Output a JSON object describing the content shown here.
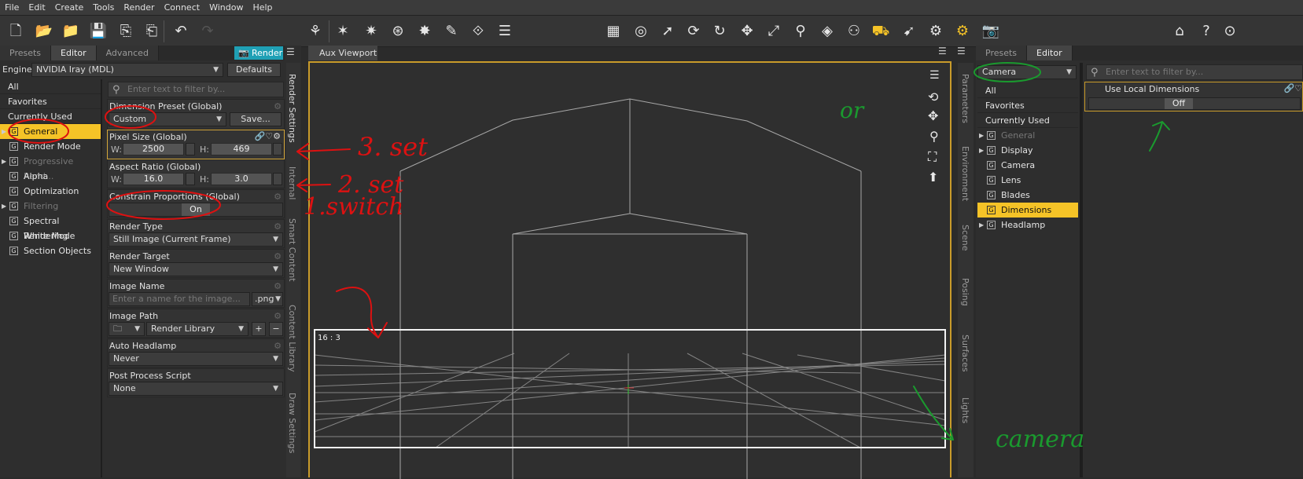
{
  "menubar": [
    "File",
    "Edit",
    "Create",
    "Tools",
    "Render",
    "Connect",
    "Window",
    "Help"
  ],
  "left_panel": {
    "tabs": [
      "Presets",
      "Editor",
      "Advanced"
    ],
    "render_button": "Render",
    "engine_label": "Engine :",
    "engine_value": "NVIDIA Iray (MDL)",
    "defaults_button": "Defaults",
    "groups": [
      {
        "label": "All",
        "type": "plain"
      },
      {
        "label": "Favorites",
        "type": "plain"
      },
      {
        "label": "Currently Used",
        "type": "plain"
      },
      {
        "label": "General",
        "type": "g",
        "state": "selected",
        "arrow": true
      },
      {
        "label": "Render Mode",
        "type": "g"
      },
      {
        "label": "Progressive Rend...",
        "type": "g",
        "state": "dim",
        "arrow": true
      },
      {
        "label": "Alpha",
        "type": "g"
      },
      {
        "label": "Optimization",
        "type": "g"
      },
      {
        "label": "Filtering",
        "type": "g",
        "state": "dim",
        "arrow": true
      },
      {
        "label": "Spectral Rendering",
        "type": "g"
      },
      {
        "label": "White Mode",
        "type": "g"
      },
      {
        "label": "Section Objects",
        "type": "g"
      }
    ]
  },
  "render_settings": {
    "filter_placeholder": "Enter text to filter by...",
    "dimension_preset": {
      "label": "Dimension Preset (Global)",
      "value": "Custom",
      "save": "Save..."
    },
    "pixel_size": {
      "label": "Pixel Size (Global)",
      "w_label": "W:",
      "w": "2500",
      "h_label": "H:",
      "h": "469"
    },
    "aspect_ratio": {
      "label": "Aspect Ratio (Global)",
      "w_label": "W:",
      "w": "16.0",
      "h_label": "H:",
      "h": "3.0"
    },
    "constrain": {
      "label": "Constrain Proportions (Global)",
      "value": "On"
    },
    "render_type": {
      "label": "Render Type",
      "value": "Still Image (Current Frame)"
    },
    "render_target": {
      "label": "Render Target",
      "value": "New Window"
    },
    "image_name": {
      "label": "Image Name",
      "placeholder": "Enter a name for the image...",
      "ext": ".png"
    },
    "image_path": {
      "label": "Image Path",
      "value": "Render Library",
      "plus": "+",
      "minus": "−"
    },
    "auto_headlamp": {
      "label": "Auto Headlamp",
      "value": "Never"
    },
    "post_process": {
      "label": "Post Process Script",
      "value": "None"
    }
  },
  "left_vtabs": [
    "Render Settings",
    "Internal",
    "Smart Content",
    "Content Library",
    "Draw Settings"
  ],
  "viewport": {
    "tab": "Aux Viewport",
    "ratio_label": "16 : 3"
  },
  "right_vtabs": [
    "Parameters",
    "Environment",
    "Scene",
    "Posing",
    "Surfaces",
    "Lights"
  ],
  "right_panel": {
    "tabs": [
      "Presets",
      "Editor"
    ],
    "node_value": "Camera",
    "filter_placeholder": "Enter text to filter by...",
    "groups": [
      {
        "label": "All",
        "type": "plain"
      },
      {
        "label": "Favorites",
        "type": "plain"
      },
      {
        "label": "Currently Used",
        "type": "plain"
      },
      {
        "label": "General",
        "type": "g",
        "state": "dim",
        "arrow": true
      },
      {
        "label": "Display",
        "type": "g",
        "arrow": true
      },
      {
        "label": "Camera",
        "type": "g"
      },
      {
        "label": "Lens",
        "type": "g"
      },
      {
        "label": "Blades",
        "type": "g"
      },
      {
        "label": "Dimensions",
        "type": "g",
        "state": "selected"
      },
      {
        "label": "Headlamp",
        "type": "g",
        "arrow": true
      }
    ],
    "use_local": {
      "label": "Use Local Dimensions",
      "value": "Off"
    }
  },
  "annotations": {
    "red_color": "#dd1111",
    "green_color": "#1a9a2e",
    "step3": "3. set",
    "step2": "2. set",
    "step1": "1.switch",
    "or": "or",
    "camera": "camera"
  }
}
